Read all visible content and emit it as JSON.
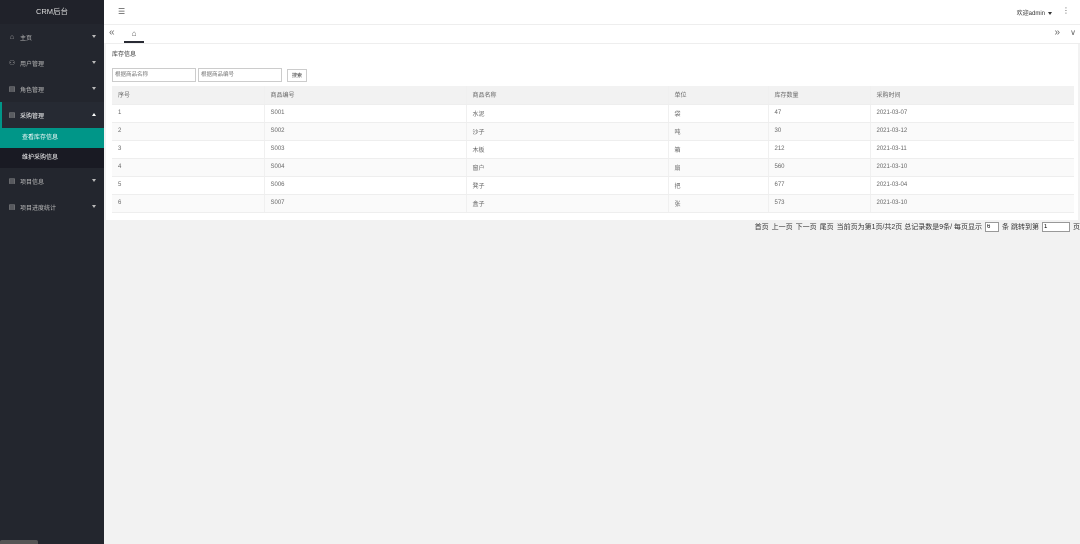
{
  "app": {
    "title": "CRM后台"
  },
  "sidebar": {
    "items": [
      {
        "label": "主页",
        "icon": "home-icon"
      },
      {
        "label": "用户管理",
        "icon": "user-icon"
      },
      {
        "label": "角色管理",
        "icon": "grid-icon"
      },
      {
        "label": "采购管理",
        "icon": "grid-icon"
      },
      {
        "label": "项目信息",
        "icon": "grid-icon"
      },
      {
        "label": "项目进度统计",
        "icon": "grid-icon"
      }
    ],
    "submenu": [
      {
        "label": "查看库存信息"
      },
      {
        "label": "维护采购信息"
      }
    ]
  },
  "header": {
    "menu_icon": "☰",
    "welcome": "欢迎admin",
    "more": "⋮"
  },
  "tabs": {
    "left": "«",
    "home": "⌂",
    "right": "»",
    "down": "∨"
  },
  "panel": {
    "title": "库存信息",
    "search": {
      "name_placeholder": "根据商品名称",
      "code_placeholder": "根据商品编号",
      "button": "搜索"
    }
  },
  "table": {
    "headers": [
      "序号",
      "商品编号",
      "商品名称",
      "单位",
      "库存数量",
      "采购时间"
    ],
    "rows": [
      [
        "1",
        "S001",
        "水泥",
        "袋",
        "47",
        "2021-03-07"
      ],
      [
        "2",
        "S002",
        "沙子",
        "吨",
        "30",
        "2021-03-12"
      ],
      [
        "3",
        "S003",
        "木板",
        "箱",
        "212",
        "2021-03-11"
      ],
      [
        "4",
        "S004",
        "窗户",
        "扇",
        "560",
        "2021-03-10"
      ],
      [
        "5",
        "S006",
        "凳子",
        "把",
        "677",
        "2021-03-04"
      ],
      [
        "6",
        "S007",
        "盒子",
        "张",
        "573",
        "2021-03-10"
      ]
    ]
  },
  "pager": {
    "first": "首页",
    "prev": "上一页",
    "next": "下一页",
    "last": "尾页",
    "summary": "当前页为第1页/共2页 总记录数是9条/ 每页显示",
    "per_page": "6",
    "jump_prefix": "条 跳转到第",
    "jump_page": "1",
    "jump_suffix": "页"
  }
}
